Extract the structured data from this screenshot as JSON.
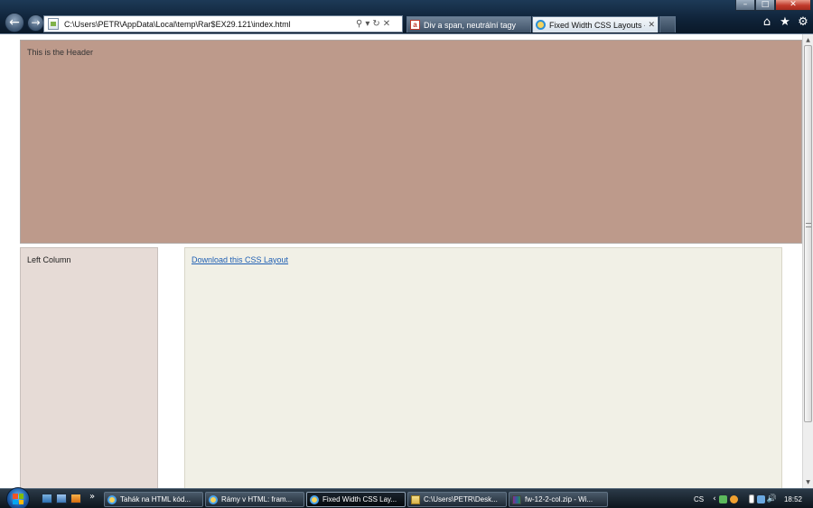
{
  "browser": {
    "address": "C:\\Users\\PETR\\AppData\\Local\\temp\\Rar$EX29.121\\index.html",
    "address_tools": {
      "search": "⚲",
      "dropdown": "▾",
      "refresh": "↻",
      "stop": "✕"
    },
    "tabs": [
      {
        "label": "Div a span, neutrální tagy",
        "icon": "red-page-icon",
        "active": false
      },
      {
        "label": "Fixed Width CSS Layouts - 2...",
        "icon": "ie-icon",
        "active": true,
        "close": "✕"
      }
    ],
    "command_icons": {
      "home": "⌂",
      "favorites": "★",
      "tools": "⚙"
    },
    "window_buttons": {
      "minimize": "–",
      "maximize": "□",
      "close": "✕"
    },
    "nav": {
      "back": "←",
      "forward": "→"
    }
  },
  "page": {
    "header_text": "This is the Header",
    "left_column_text": "Left Column",
    "download_link": "Download this CSS Layout",
    "colors": {
      "header_bg": "#bd9a8b",
      "left_col_bg": "#e6dbd6",
      "main_col_bg": "#f1f0e6",
      "link": "#1f5fb3"
    }
  },
  "taskbar": {
    "quicklaunch_more": "»",
    "buttons": [
      {
        "label": "Tahák na HTML kód...",
        "icon": "ie-icon",
        "active": false
      },
      {
        "label": "Rámy v HTML: fram...",
        "icon": "ie-icon",
        "active": false
      },
      {
        "label": "Fixed Width CSS Lay...",
        "icon": "ie-icon",
        "active": true
      },
      {
        "label": "C:\\Users\\PETR\\Desk...",
        "icon": "folder-icon",
        "active": false
      },
      {
        "label": "fw-12-2-col.zip - Wi...",
        "icon": "winrar-icon",
        "active": false
      }
    ],
    "tray": {
      "language": "CS",
      "chevron": "‹",
      "volume": "🔊",
      "clock": "18:52"
    }
  }
}
